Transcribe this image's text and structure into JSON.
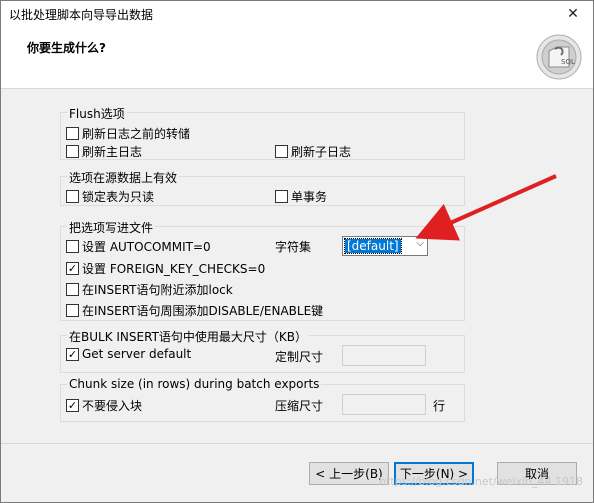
{
  "window": {
    "title": "以批处理脚本向导导出数据",
    "close_glyph": "✕"
  },
  "header": {
    "title": "你要生成什么?",
    "icon_name": "sql-wizard-icon",
    "icon_text": "SQL"
  },
  "groups": {
    "flush": {
      "legend": "Flush选项",
      "items": [
        {
          "label": "刷新日志之前的转储",
          "checked": false
        },
        {
          "label": "刷新主日志",
          "checked": false
        },
        {
          "label": "刷新子日志",
          "checked": false
        }
      ]
    },
    "source": {
      "legend": "选项在源数据上有效",
      "items": [
        {
          "label": "锁定表为只读",
          "checked": false
        },
        {
          "label": "单事务",
          "checked": false
        }
      ]
    },
    "write": {
      "legend": "把选项写进文件",
      "items": [
        {
          "label": "设置 AUTOCOMMIT=0",
          "checked": false
        },
        {
          "label": "设置 FOREIGN_KEY_CHECKS=0",
          "checked": true
        },
        {
          "label": "在INSERT语句附近添加lock",
          "checked": false
        },
        {
          "label": "在INSERT语句周围添加DISABLE/ENABLE键",
          "checked": false
        }
      ],
      "charset_label": "字符集",
      "charset_value": "[default]"
    },
    "bulk": {
      "legend": "在BULK INSERT语句中使用最大尺寸（KB）",
      "item": {
        "label": "Get server default",
        "checked": true
      },
      "custom_label": "定制尺寸",
      "custom_value": ""
    },
    "chunk": {
      "legend": "Chunk size (in rows) during batch exports",
      "item": {
        "label": "不要侵入块",
        "checked": true
      },
      "compress_label": "压缩尺寸",
      "compress_value": "",
      "unit": "行"
    }
  },
  "buttons": {
    "back": "< 上一步(B)",
    "next": "下一步(N) >",
    "cancel": "取消"
  },
  "watermark": "https://blog.csdn.net/weixin_44 1918",
  "colors": {
    "accent": "#0078d7",
    "arrow": "#e02020"
  }
}
